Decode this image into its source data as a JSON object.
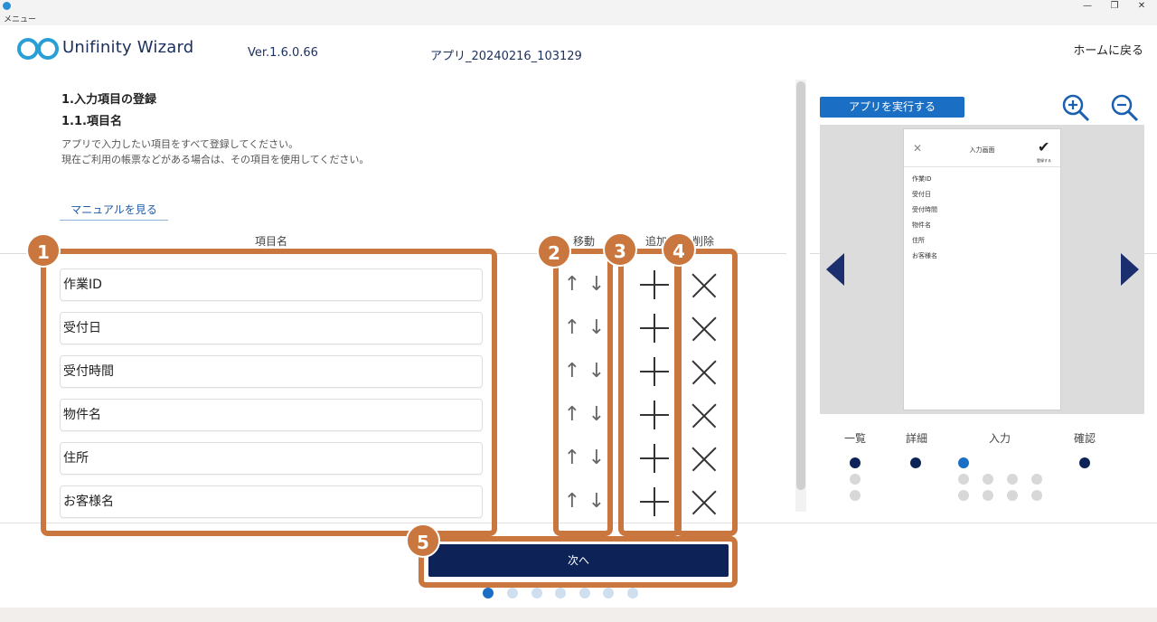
{
  "window": {
    "title": "メニュー",
    "controls": [
      "—",
      "❐",
      "✕"
    ]
  },
  "header": {
    "brand": "Unifinity Wizard",
    "version": "Ver.1.6.0.66",
    "app_name": "アプリ_20240216_103129",
    "home_link": "ホームに戻る"
  },
  "section": {
    "title": "1.入力項目の登録",
    "subtitle": "1.1.項目名",
    "description_line1": "アプリで入力したい項目をすべて登録してください。",
    "description_line2": "現在ご利用の帳票などがある場合は、その項目を使用してください。",
    "manual_link": "マニュアルを見る"
  },
  "columns": {
    "item_name": "項目名",
    "move": "移動",
    "add": "追加",
    "delete": "削除"
  },
  "items": [
    {
      "label": "作業ID"
    },
    {
      "label": "受付日"
    },
    {
      "label": "受付時間"
    },
    {
      "label": "物件名"
    },
    {
      "label": "住所"
    },
    {
      "label": "お客様名"
    }
  ],
  "icons": {
    "up": "↑",
    "down": "↓",
    "add": "plus-icon",
    "delete": "close-icon"
  },
  "callouts": [
    "1",
    "2",
    "3",
    "4",
    "5"
  ],
  "footer": {
    "next_button": "次へ",
    "step_total": 7,
    "step_current": 1
  },
  "preview": {
    "run_button": "アプリを実行する",
    "phone_title": "入力画面",
    "phone_confirm_label": "登録する",
    "phone_items": [
      "作業ID",
      "受付日",
      "受付時間",
      "物件名",
      "住所",
      "お客様名"
    ],
    "screens": [
      "一覧",
      "詳細",
      "入力",
      "確認"
    ]
  },
  "colors": {
    "accent_navy": "#0d2257",
    "accent_blue": "#1a6fc4",
    "callout_orange": "#c9773f"
  }
}
